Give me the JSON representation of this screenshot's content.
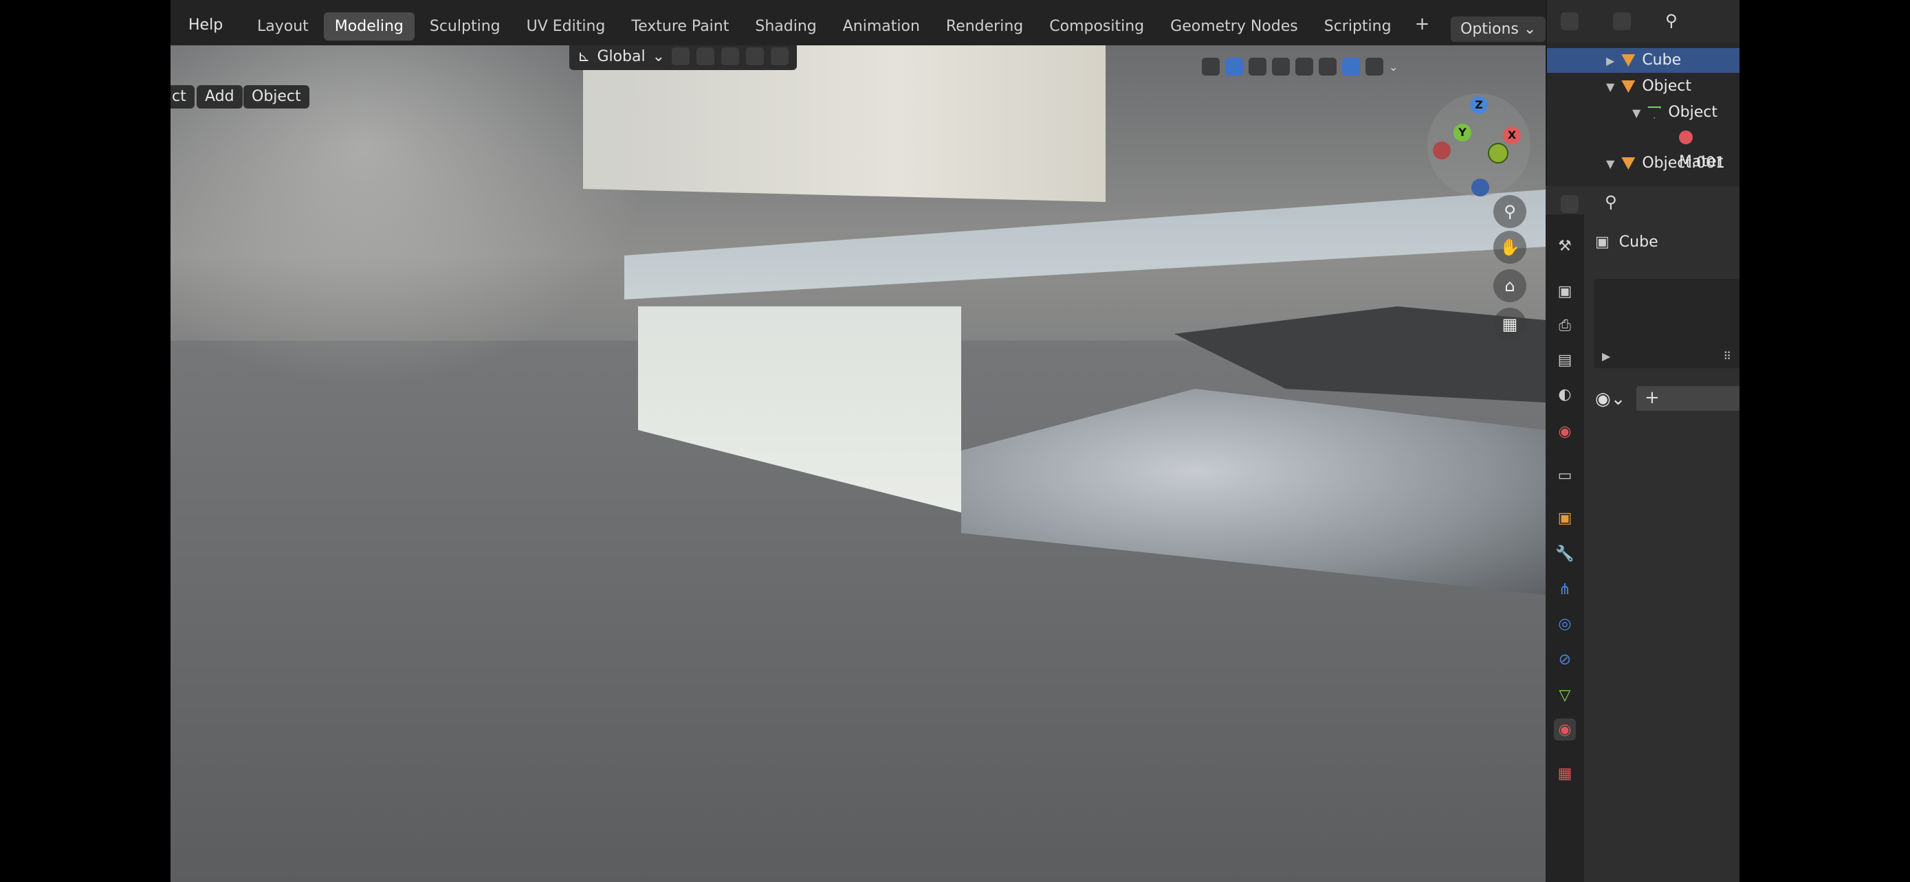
{
  "menu": {
    "help": "Help"
  },
  "workspace_tabs": [
    "Layout",
    "Modeling",
    "Sculpting",
    "UV Editing",
    "Texture Paint",
    "Shading",
    "Animation",
    "Rendering",
    "Compositing",
    "Geometry Nodes",
    "Scripting"
  ],
  "active_tab": "Modeling",
  "add_tab_symbol": "+",
  "options_label": "Options",
  "viewport_header": {
    "select_partial": "ct",
    "add": "Add",
    "object": "Object",
    "transform_orientation": "Global"
  },
  "gizmo": {
    "z": "Z",
    "y": "Y",
    "x": "X"
  },
  "outliner": {
    "rows": [
      {
        "name": "Cube",
        "kind": "object",
        "selected": true
      },
      {
        "name": "Object",
        "kind": "object",
        "selected": false
      },
      {
        "name": "Object",
        "kind": "mesh",
        "selected": false
      },
      {
        "name": "Mater",
        "kind": "material",
        "selected": false
      },
      {
        "name": "Object.001",
        "kind": "object",
        "selected": false
      }
    ]
  },
  "properties": {
    "object_name": "Cube",
    "new_slot": "+"
  },
  "colors": {
    "selection": "#35558a",
    "active_tab": "#4a4a4a",
    "accent_blue": "#3c73c9"
  }
}
